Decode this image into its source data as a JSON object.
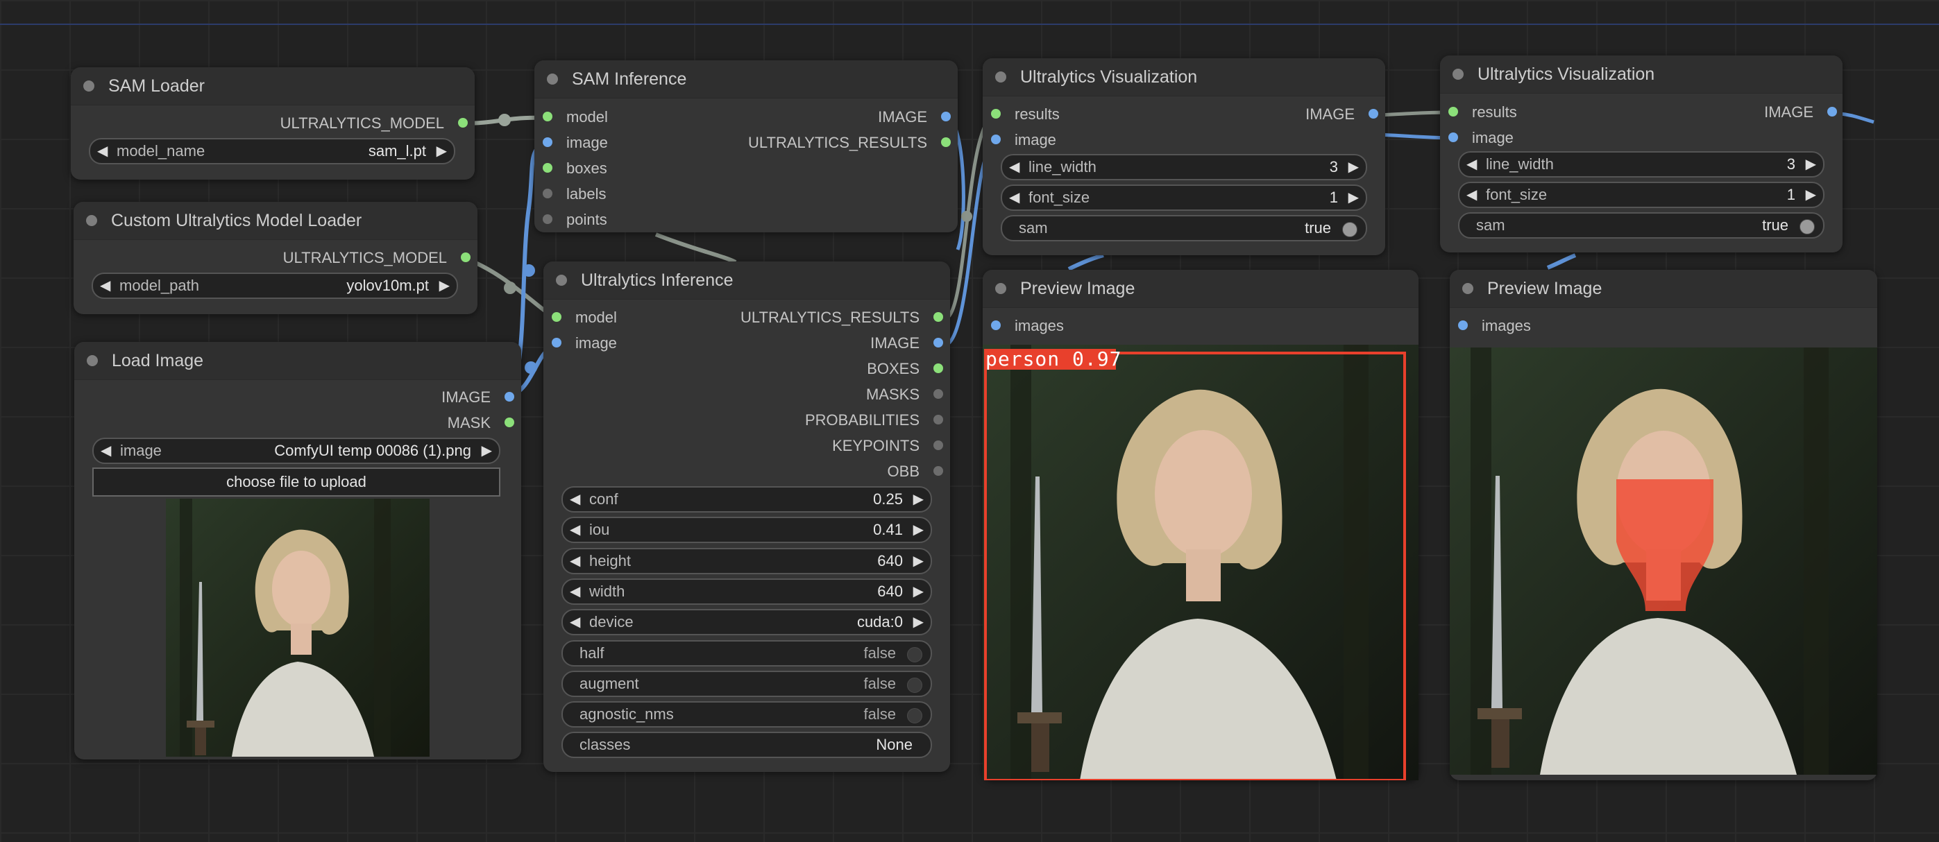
{
  "nodes": {
    "sam_loader": {
      "title": "SAM Loader",
      "outputs": [
        "ULTRALYTICS_MODEL"
      ],
      "widgets": {
        "model_name": {
          "label": "model_name",
          "value": "sam_l.pt"
        }
      }
    },
    "custom_loader": {
      "title": "Custom Ultralytics Model Loader",
      "outputs": [
        "ULTRALYTICS_MODEL"
      ],
      "widgets": {
        "model_path": {
          "label": "model_path",
          "value": "yolov10m.pt"
        }
      }
    },
    "load_image": {
      "title": "Load Image",
      "outputs": [
        "IMAGE",
        "MASK"
      ],
      "widgets": {
        "image": {
          "label": "image",
          "value": "ComfyUI temp 00086 (1).png"
        }
      },
      "upload_button": "choose file to upload"
    },
    "sam_inference": {
      "title": "SAM Inference",
      "inputs": [
        "model",
        "image",
        "boxes",
        "labels",
        "points"
      ],
      "outputs": [
        "IMAGE",
        "ULTRALYTICS_RESULTS"
      ]
    },
    "ultra_inference": {
      "title": "Ultralytics Inference",
      "inputs": [
        "model",
        "image"
      ],
      "outputs": [
        "ULTRALYTICS_RESULTS",
        "IMAGE",
        "BOXES",
        "MASKS",
        "PROBABILITIES",
        "KEYPOINTS",
        "OBB"
      ],
      "widgets": {
        "conf": {
          "label": "conf",
          "value": "0.25"
        },
        "iou": {
          "label": "iou",
          "value": "0.41"
        },
        "height": {
          "label": "height",
          "value": "640"
        },
        "width": {
          "label": "width",
          "value": "640"
        },
        "device": {
          "label": "device",
          "value": "cuda:0"
        },
        "half": {
          "label": "half",
          "value": "false"
        },
        "augment": {
          "label": "augment",
          "value": "false"
        },
        "agnostic_nms": {
          "label": "agnostic_nms",
          "value": "false"
        },
        "classes": {
          "label": "classes",
          "value": "None"
        }
      }
    },
    "viz1": {
      "title": "Ultralytics Visualization",
      "inputs": [
        "results",
        "image"
      ],
      "outputs": [
        "IMAGE"
      ],
      "widgets": {
        "line_width": {
          "label": "line_width",
          "value": "3"
        },
        "font_size": {
          "label": "font_size",
          "value": "1"
        },
        "sam": {
          "label": "sam",
          "value": "true"
        }
      }
    },
    "viz2": {
      "title": "Ultralytics Visualization",
      "inputs": [
        "results",
        "image"
      ],
      "outputs": [
        "IMAGE"
      ],
      "widgets": {
        "line_width": {
          "label": "line_width",
          "value": "3"
        },
        "font_size": {
          "label": "font_size",
          "value": "1"
        },
        "sam": {
          "label": "sam",
          "value": "true"
        }
      }
    },
    "preview1": {
      "title": "Preview Image",
      "inputs": [
        "images"
      ],
      "detection_label": "person 0.97"
    },
    "preview2": {
      "title": "Preview Image",
      "inputs": [
        "images"
      ]
    }
  },
  "slot_colors": {
    "model": "#8ce07a",
    "image": "#6fa8ec",
    "results": "#8ce07a",
    "other": "#6d6d6d",
    "mask": "#8ce07a"
  },
  "accent": {
    "detection_box": "#e8402c",
    "mask_overlay": "#f04a33"
  }
}
